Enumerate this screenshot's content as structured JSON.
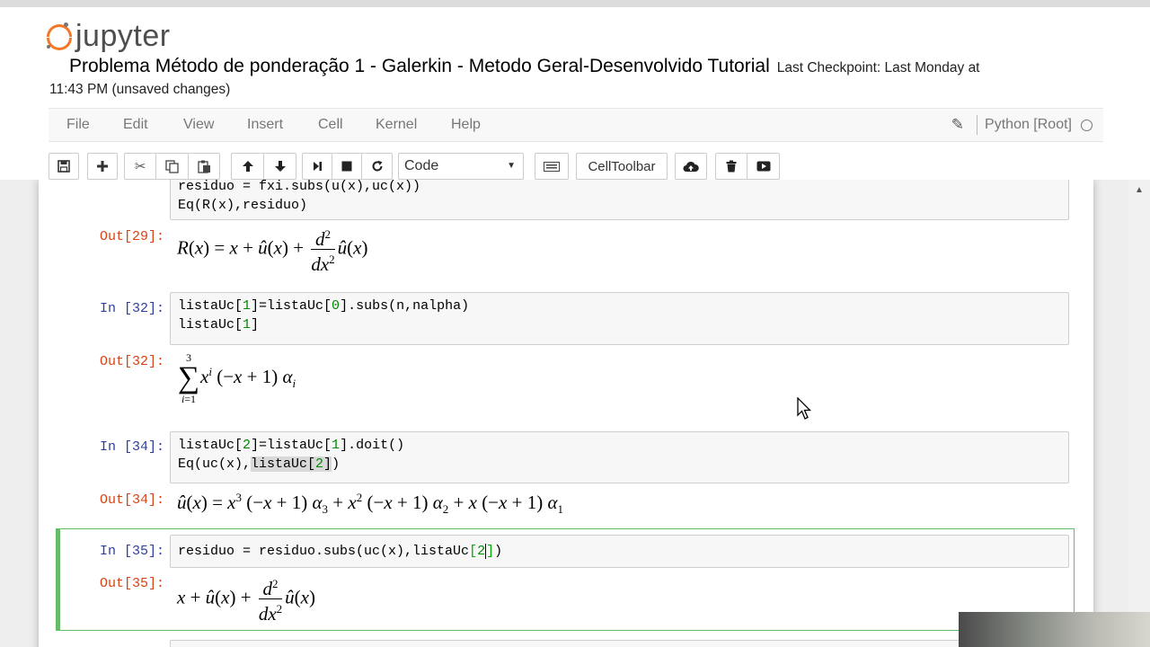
{
  "header": {
    "logo_text": "jupyter",
    "notebook_title": "Problema Método de ponderação 1 - Galerkin - Metodo Geral-Desenvolvido Tutorial",
    "checkpoint_part1": "Last Checkpoint: Last Monday at",
    "checkpoint_part2": "11:43 PM (unsaved changes)"
  },
  "menu": {
    "items": [
      "File",
      "Edit",
      "View",
      "Insert",
      "Cell",
      "Kernel",
      "Help"
    ],
    "kernel_name": "Python [Root]"
  },
  "toolbar": {
    "cell_type": "Code",
    "celltoolbar_label": "CellToolbar",
    "icons": [
      "save-icon",
      "plus-icon",
      "cut-icon",
      "copy-icon",
      "paste-icon",
      "arrow-up-icon",
      "arrow-down-icon",
      "step-forward-icon",
      "stop-icon",
      "restart-icon",
      "keyboard-icon",
      "cloud-upload-icon",
      "trash-icon",
      "present-icon"
    ]
  },
  "cells": [
    {
      "code_lines": [
        "residuo = fxi.subs(u(x),uc(x))",
        "Eq(R(x),residuo)"
      ],
      "out_prompt": "Out[29]:"
    },
    {
      "in_prompt": "In [32]:",
      "code_line1_a": "listaUc[",
      "code_line1_b": "1",
      "code_line1_c": "]=listaUc[",
      "code_line1_d": "0",
      "code_line1_e": "].subs(n,nalpha)",
      "code_line2_a": "listaUc[",
      "code_line2_b": "1",
      "code_line2_c": "]",
      "out_prompt": "Out[32]:"
    },
    {
      "in_prompt": "In [34]:",
      "code_line1_a": "listaUc[",
      "code_line1_b": "2",
      "code_line1_c": "]=listaUc[",
      "code_line1_d": "1",
      "code_line1_e": "].doit()",
      "code_line2_a": "Eq(uc(x),",
      "code_line2_b": "listaUc[",
      "code_line2_c": "2",
      "code_line2_d": "]",
      "code_line2_e": ")",
      "out_prompt": "Out[34]:"
    },
    {
      "in_prompt": "In [35]:",
      "code_a": "residuo = residuo.subs(uc(x),listaUc",
      "code_b": "[",
      "code_c": "2",
      "code_d": "]",
      "code_e": ")",
      "out_prompt": "Out[35]:"
    }
  ],
  "colors": {
    "logo_orange": "#f37726",
    "in_prompt": "#303f9f",
    "out_prompt": "#d84315",
    "selected_cell_border": "#66bb6a"
  }
}
